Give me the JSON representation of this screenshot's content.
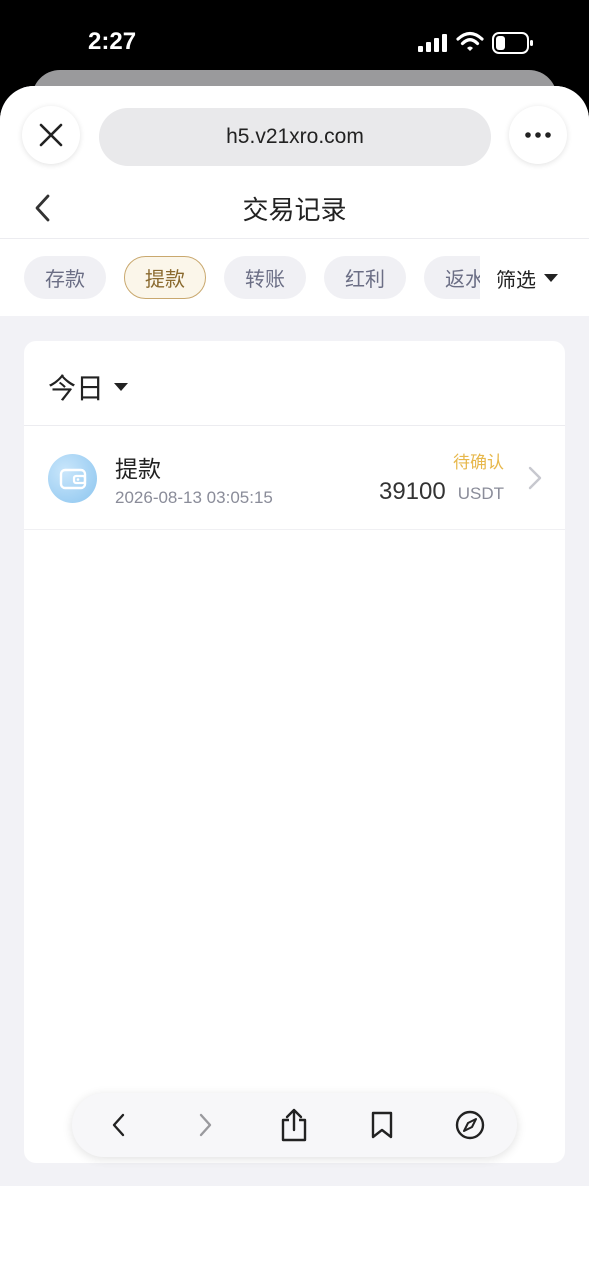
{
  "status_bar": {
    "time": "2:27"
  },
  "browser": {
    "url": "h5.v21xro.com"
  },
  "header": {
    "title": "交易记录"
  },
  "tabs": [
    {
      "label": "存款",
      "active": false
    },
    {
      "label": "提款",
      "active": true
    },
    {
      "label": "转账",
      "active": false
    },
    {
      "label": "红利",
      "active": false
    },
    {
      "label": "返水",
      "active": false
    }
  ],
  "filter": {
    "label": "筛选"
  },
  "date_filter": {
    "label": "今日"
  },
  "records": [
    {
      "type": "提款",
      "time": "2026-08-13 03:05:15",
      "status": "待确认",
      "amount": "39100",
      "unit": "USDT"
    }
  ],
  "colors": {
    "accent_gold": "#c9a86e",
    "status_pending": "#e7b84c",
    "avatar_blue": "#8cc5ef"
  }
}
